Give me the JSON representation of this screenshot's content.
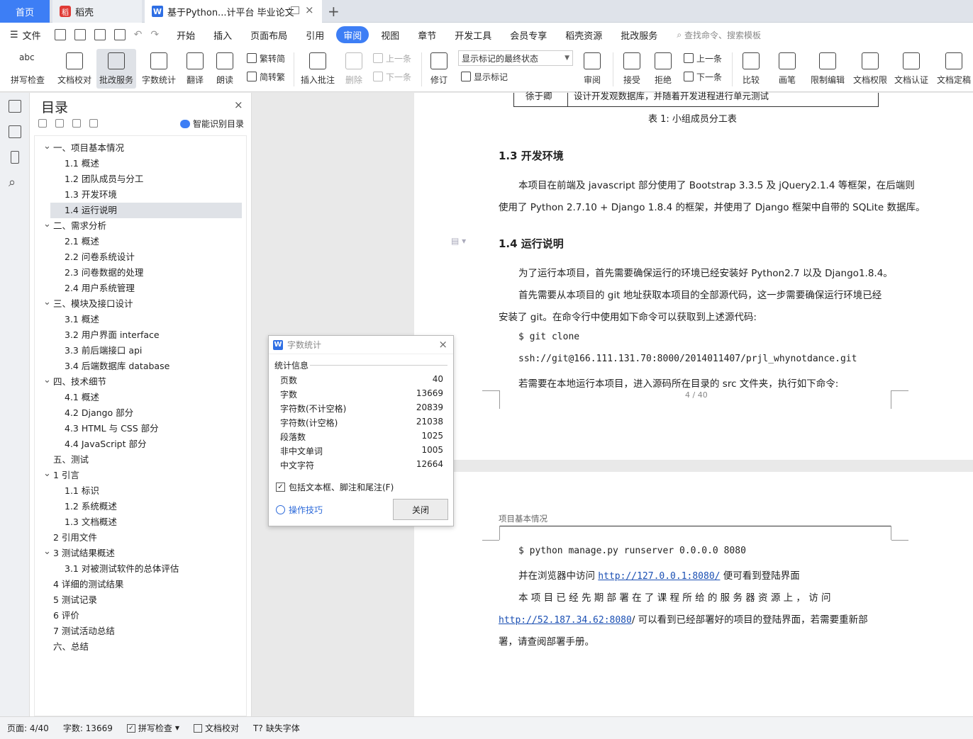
{
  "tabs": {
    "home": "首页",
    "daoke": "稻壳",
    "doc": "基于Python...计平台 毕业论文"
  },
  "menu": {
    "file": "文件",
    "items": [
      "开始",
      "插入",
      "页面布局",
      "引用",
      "审阅",
      "视图",
      "章节",
      "开发工具",
      "会员专享",
      "稻壳资源",
      "批改服务"
    ],
    "active": "审阅",
    "search": "查找命令、搜索模板"
  },
  "ribbon": {
    "spell": "拼写检查",
    "proof": "文档校对",
    "correct": "批改服务",
    "count": "字数统计",
    "translate": "翻译",
    "read": "朗读",
    "trad": "繁转简",
    "simp": "简转繁",
    "insert_comment": "插入批注",
    "delete": "删除",
    "prev": "上一条",
    "next": "下一条",
    "revise": "修订",
    "mark_state": "显示标记的最终状态",
    "show_marks": "显示标记",
    "review": "审阅",
    "accept": "接受",
    "reject": "拒绝",
    "prev2": "上一条",
    "next2": "下一条",
    "compare": "比较",
    "pen": "画笔",
    "restrict": "限制编辑",
    "perm": "文档权限",
    "cert": "文档认证",
    "final": "文档定稿"
  },
  "toc": {
    "title": "目录",
    "smart": "智能识别目录",
    "items": [
      {
        "level": 1,
        "text": "一、项目基本情况",
        "open": true
      },
      {
        "level": 2,
        "text": "1.1 概述"
      },
      {
        "level": 2,
        "text": "1.2 团队成员与分工"
      },
      {
        "level": 2,
        "text": "1.3 开发环境"
      },
      {
        "level": 2,
        "text": "1.4 运行说明",
        "selected": true
      },
      {
        "level": 1,
        "text": "二、需求分析",
        "open": true
      },
      {
        "level": 2,
        "text": "2.1 概述"
      },
      {
        "level": 2,
        "text": "2.2 问卷系统设计"
      },
      {
        "level": 2,
        "text": "2.3 问卷数据的处理"
      },
      {
        "level": 2,
        "text": "2.4 用户系统管理"
      },
      {
        "level": 1,
        "text": "三、模块及接口设计",
        "open": true
      },
      {
        "level": 2,
        "text": "3.1 概述"
      },
      {
        "level": 2,
        "text": "3.2 用户界面 interface"
      },
      {
        "level": 2,
        "text": "3.3 前后端接口 api"
      },
      {
        "level": 2,
        "text": "3.4 后端数据库 database"
      },
      {
        "level": 1,
        "text": "四、技术细节",
        "open": true
      },
      {
        "level": 2,
        "text": "4.1 概述"
      },
      {
        "level": 2,
        "text": "4.2 Django 部分"
      },
      {
        "level": 2,
        "text": "4.3 HTML 与 CSS 部分"
      },
      {
        "level": 2,
        "text": "4.4 JavaScript 部分"
      },
      {
        "level": 1,
        "text": "五、测试"
      },
      {
        "level": 1,
        "text": "1 引言",
        "open": true
      },
      {
        "level": 2,
        "text": "1.1 标识"
      },
      {
        "level": 2,
        "text": "1.2 系统概述"
      },
      {
        "level": 2,
        "text": "1.3 文档概述"
      },
      {
        "level": 1,
        "text": "2 引用文件"
      },
      {
        "level": 1,
        "text": "3 测试结果概述",
        "open": true
      },
      {
        "level": 2,
        "text": "3.1 对被测试软件的总体评估"
      },
      {
        "level": 1,
        "text": "4 详细的测试结果"
      },
      {
        "level": 1,
        "text": "5 测试记录"
      },
      {
        "level": 1,
        "text": "6 评价"
      },
      {
        "level": 1,
        "text": "7 测试活动总结"
      },
      {
        "level": 1,
        "text": "六、总结"
      }
    ]
  },
  "doc": {
    "table_cell_1": "徐于卿",
    "table_cell_2": "设计开发观数据库，并随着开发进程进行单元测试",
    "caption": "表 1: 小组成员分工表",
    "h13": "1.3 开发环境",
    "p13a": "本项目在前端及 javascript 部分使用了 Bootstrap 3.3.5 及 jQuery2.1.4 等框架，在后端则",
    "p13b": "使用了 Python 2.7.10 + Django 1.8.4 的框架，并使用了 Django 框架中自带的 SQLite 数据库。",
    "h14": "1.4 运行说明",
    "p14a": "为了运行本项目，首先需要确保运行的环境已经安装好 Python2.7 以及 Django1.8.4。",
    "p14b": "首先需要从本项目的 git 地址获取本项目的全部源代码，这一步需要确保运行环境已经",
    "p14c": "安装了 git。在命令行中使用如下命令可以获取到上述源代码:",
    "cmd1": "$ git clone",
    "cmd2": "ssh://git@166.111.131.70:8000/2014011407/prjl_whynotdance.git",
    "p14d": "若需要在本地运行本项目，进入源码所在目录的 src 文件夹，执行如下命令:",
    "pagenum": "4 / 40",
    "header2": "项目基本情况",
    "cmd3": "$ python manage.py runserver 0.0.0.0 8080",
    "p2a_pre": "并在浏览器中访问 ",
    "p2a_link": "http://127.0.0.1:8080/",
    "p2a_post": " 便可看到登陆界面",
    "p2b": "本 项 目 已 经 先 期 部 署 在 了 课 程 所 给 的 服 务 器 资 源 上 ， 访 问",
    "p2c_link": "http://52.187.34.62:8080",
    "p2c_post": "/ 可以看到已经部署好的项目的登陆界面，若需要重新部",
    "p2d": "署，请查阅部署手册。"
  },
  "dialog": {
    "title": "字数统计",
    "section": "统计信息",
    "rows": [
      {
        "label": "页数",
        "value": "40"
      },
      {
        "label": "字数",
        "value": "13669"
      },
      {
        "label": "字符数(不计空格)",
        "value": "20839"
      },
      {
        "label": "字符数(计空格)",
        "value": "21038"
      },
      {
        "label": "段落数",
        "value": "1025"
      },
      {
        "label": "非中文单词",
        "value": "1005"
      },
      {
        "label": "中文字符",
        "value": "12664"
      }
    ],
    "checkbox": "包括文本框、脚注和尾注(F)",
    "tips": "操作技巧",
    "close": "关闭"
  },
  "status": {
    "page": "页面: 4/40",
    "words": "字数: 13669",
    "spell": "拼写检查",
    "proof": "文档校对",
    "font": "缺失字体"
  }
}
